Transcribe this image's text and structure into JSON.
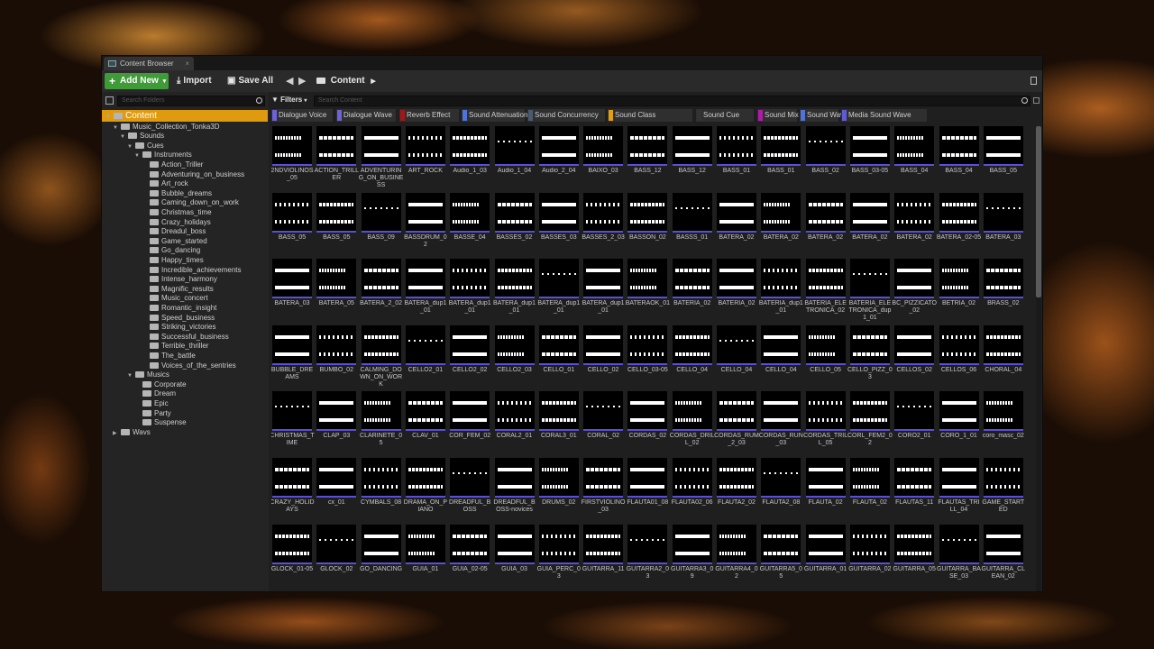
{
  "window": {
    "tab_title": "Content Browser",
    "close": "×"
  },
  "toolbar": {
    "add_new": "Add New",
    "import": "Import",
    "save_all": "Save All",
    "breadcrumb": "Content"
  },
  "sources": {
    "search_placeholder": "Search Folders"
  },
  "content": {
    "filters_label": "Filters",
    "search_placeholder": "Search Content"
  },
  "colors": {
    "accent": "#e09a10",
    "add_new": "#3f9a38",
    "sound_wave_underline": "#5a4fd8"
  },
  "filters": [
    {
      "label": "Dialogue Voice",
      "color": "#6f62d8"
    },
    {
      "label": "Dialogue Wave",
      "color": "#6f62d8"
    },
    {
      "label": "Reverb Effect",
      "color": "#a01818"
    },
    {
      "label": "Sound Attenuation",
      "color": "#4f73d8"
    },
    {
      "label": "Sound Concurrency",
      "color": "#4a5a70"
    },
    {
      "label": "Sound Class",
      "color": "#e0a010"
    },
    {
      "label": "Sound Cue",
      "color": "#333333"
    },
    {
      "label": "Sound Mix",
      "color": "#b01aa8"
    },
    {
      "label": "Sound Wave",
      "color": "#4f73d8"
    },
    {
      "label": "Media Sound Wave",
      "color": "#5f5ad8"
    }
  ],
  "tree": [
    {
      "label": "Content",
      "depth": 0,
      "selected": true,
      "arrow": "▼"
    },
    {
      "label": "Music_Collection_Tonka3D",
      "depth": 1,
      "arrow": "▼"
    },
    {
      "label": "Sounds",
      "depth": 2,
      "arrow": "▼"
    },
    {
      "label": "Cues",
      "depth": 3,
      "arrow": "▼"
    },
    {
      "label": "Instruments",
      "depth": 4,
      "arrow": "▼"
    },
    {
      "label": "Action_Triller",
      "depth": 5
    },
    {
      "label": "Adventuring_on_business",
      "depth": 5
    },
    {
      "label": "Art_rock",
      "depth": 5
    },
    {
      "label": "Bubble_dreams",
      "depth": 5
    },
    {
      "label": "Caming_down_on_work",
      "depth": 5
    },
    {
      "label": "Christmas_time",
      "depth": 5
    },
    {
      "label": "Crazy_holidays",
      "depth": 5
    },
    {
      "label": "Dreadul_boss",
      "depth": 5
    },
    {
      "label": "Game_started",
      "depth": 5
    },
    {
      "label": "Go_dancing",
      "depth": 5
    },
    {
      "label": "Happy_times",
      "depth": 5
    },
    {
      "label": "Incredible_achievements",
      "depth": 5
    },
    {
      "label": "Intense_harmony",
      "depth": 5
    },
    {
      "label": "Magnific_results",
      "depth": 5
    },
    {
      "label": "Music_concert",
      "depth": 5
    },
    {
      "label": "Romantic_insight",
      "depth": 5
    },
    {
      "label": "Speed_business",
      "depth": 5
    },
    {
      "label": "Striking_victories",
      "depth": 5
    },
    {
      "label": "Successful_business",
      "depth": 5
    },
    {
      "label": "Terrible_thriller",
      "depth": 5
    },
    {
      "label": "The_battle",
      "depth": 5
    },
    {
      "label": "Voices_of_the_sentries",
      "depth": 5
    },
    {
      "label": "Musics",
      "depth": 3,
      "arrow": "▼"
    },
    {
      "label": "Corporate",
      "depth": 4
    },
    {
      "label": "Dream",
      "depth": 4
    },
    {
      "label": "Epic",
      "depth": 4
    },
    {
      "label": "Party",
      "depth": 4
    },
    {
      "label": "Suspense",
      "depth": 4
    },
    {
      "label": "Wavs",
      "depth": 1,
      "arrow": "▶"
    }
  ],
  "assets": [
    "2NDVIOLINOS_05",
    "ACTION_TRILLER",
    "ADVENTURING_ON_BUSINESS",
    "ART_ROCK",
    "Audio_1_03",
    "Audio_1_04",
    "Audio_2_04",
    "BAIXO_03",
    "BASS_12",
    "BASS_12",
    "BASS_01",
    "BASS_01",
    "BASS_02",
    "BASS_03-05",
    "BASS_04",
    "BASS_04",
    "BASS_05",
    "BASS_05",
    "BASS_05",
    "BASS_09",
    "BASSDRUM_02",
    "BASSE_04",
    "BASSES_02",
    "BASSES_03",
    "BASSES_2_03",
    "BASSON_02",
    "BASSS_01",
    "BATERA_02",
    "BATERA_02",
    "BATERA_02",
    "BATERA_02",
    "BATERA_02",
    "BATERA_02-05",
    "BATERA_03",
    "BATERA_03",
    "BATERA_05",
    "BATERA_2_02",
    "BATERA_dup1_01",
    "BATERA_dup1_01",
    "BATERA_dup1_01",
    "BATERA_dup1_01",
    "BATERA_dup1_01",
    "BATERAOK_01",
    "BATERIA_02",
    "BATERIA_02",
    "BATERIA_dup1_01",
    "BATERIA_ELETRONICA_02",
    "BATERIA_ELETRONICA_dup1_01",
    "BC_PIZZICATO_02",
    "BETRIA_02",
    "BRASS_02",
    "BUBBLE_DREAMS",
    "BUMBO_02",
    "CALMING_DOWN_ON_WORK",
    "CELLO2_01",
    "CELLO2_02",
    "CELLO2_03",
    "CELLO_01",
    "CELLO_02",
    "CELLO_03-05",
    "CELLO_04",
    "CELLO_04",
    "CELLO_04",
    "CELLO_05",
    "CELLO_PIZZ_03",
    "CELLOS_02",
    "CELLOS_06",
    "CHORAL_04",
    "CHRISTMAS_TIME",
    "CLAP_03",
    "CLARINETE_05",
    "CLAV_01",
    "COR_FEM_02",
    "CORAL2_01",
    "CORAL3_01",
    "CORAL_02",
    "CORDAS_02",
    "CORDAS_DRILL_02",
    "CORDAS_RUM_2_03",
    "CORDAS_RUN_03",
    "CORDAS_TRILL_05",
    "CORL_FEM2_02",
    "CORO2_01",
    "CORO_1_01",
    "coro_masc_02",
    "CRAZY_HOLIDAYS",
    "cx_01",
    "CYMBALS_08",
    "DRAMA_ON_PIANO",
    "DREADFUL_BOSS",
    "DREADFUL_BOSS-novices",
    "DRUMS_02",
    "FIRSTVIOLINO_03",
    "FLAUTA01_08",
    "FLAUTA02_06",
    "FLAUTA2_02",
    "FLAUTA2_08",
    "FLAUTA_02",
    "FLAUTA_02",
    "FLAUTAS_11",
    "FLAUTAS_TRILL_04",
    "GAME_STARTED",
    "GLOCK_01-05",
    "GLOCK_02",
    "GO_DANCING",
    "GUIA_01",
    "GUIA_02-05",
    "GUIA_03",
    "GUIA_PERC_03",
    "GUITARRA_11",
    "GUITARRA2_03",
    "GUITARRA3_09",
    "GUITARRA4_02",
    "GUITARRA5_05",
    "GUITARRA_01",
    "GUITARRA_02",
    "GUITARRA_05",
    "GUITARRA_BASE_03",
    "GUITARRA_CLEAN_02"
  ]
}
